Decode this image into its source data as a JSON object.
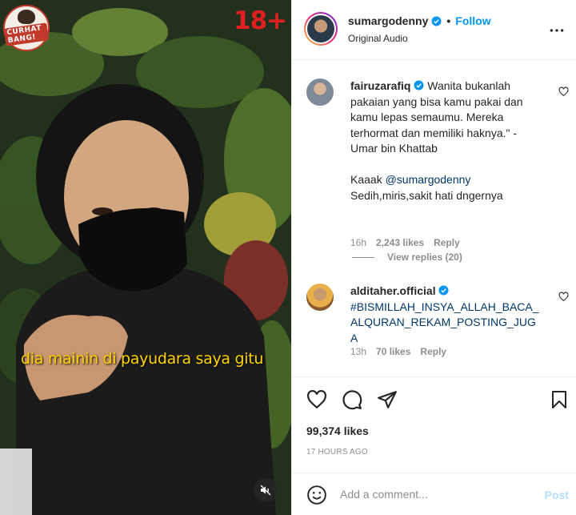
{
  "video": {
    "logo_text": "CURHAT BANG!",
    "rating": "18+",
    "subtitle": "dia mainin di payudara saya gitu",
    "mute_icon": "speaker-muted-icon"
  },
  "post": {
    "owner": "sumargodenny",
    "separator": "•",
    "follow_label": "Follow",
    "audio": "Original Audio",
    "more_icon": "more-horizontal-icon"
  },
  "comments": [
    {
      "user": "fairuzarafiq",
      "verified": true,
      "text_1": " Wanita bukanlah pakaian yang bisa kamu pakai dan kamu lepas semaumu. Mereka terhormat dan memiliki haknya.\" - Umar bin Khattab",
      "text_2": "Kaaak ",
      "mention": "@sumargodenny",
      "text_3": "Sedih,miris,sakit hati dngernya",
      "time": "16h",
      "likes": "2,243 likes",
      "reply_label": "Reply",
      "view_replies": "View replies (20)"
    },
    {
      "user": "alditaher.official",
      "verified": true,
      "hashtag": "#BISMILLAH_INSYA_ALLAH_BACA_ALQURAN_REKAM_POSTING_JUGA",
      "time": "13h",
      "likes": "70 likes",
      "reply_label": "Reply"
    }
  ],
  "actions": {
    "likes_count": "99,374 likes",
    "post_time": "17 HOURS AGO"
  },
  "composer": {
    "placeholder": "Add a comment...",
    "post_label": "Post"
  },
  "colors": {
    "accent": "#0095f6",
    "subtitle": "#ffd400",
    "rating": "#e02020",
    "muted_text": "#8e8e8e",
    "link": "#00376b"
  }
}
